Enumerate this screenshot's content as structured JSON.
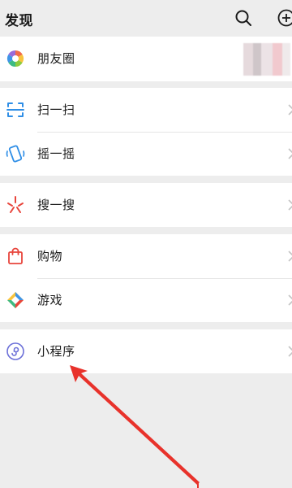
{
  "header": {
    "title": "发现",
    "search_icon": "search-icon",
    "add_icon": "plus-circle-icon"
  },
  "groups": [
    {
      "items": [
        {
          "label": "朋友圈",
          "icon": "moments-aperture-icon"
        }
      ]
    },
    {
      "items": [
        {
          "label": "扫一扫",
          "icon": "scan-icon"
        },
        {
          "label": "摇一摇",
          "icon": "shake-icon"
        }
      ]
    },
    {
      "items": [
        {
          "label": "搜一搜",
          "icon": "search-sparkle-icon"
        }
      ]
    },
    {
      "items": [
        {
          "label": "购物",
          "icon": "shopping-bag-icon"
        },
        {
          "label": "游戏",
          "icon": "game-diamond-icon"
        }
      ]
    },
    {
      "items": [
        {
          "label": "小程序",
          "icon": "mini-program-icon"
        }
      ]
    }
  ],
  "colors": {
    "background": "#ededed",
    "row_background": "#ffffff",
    "annotation_arrow": "#e8322b"
  }
}
